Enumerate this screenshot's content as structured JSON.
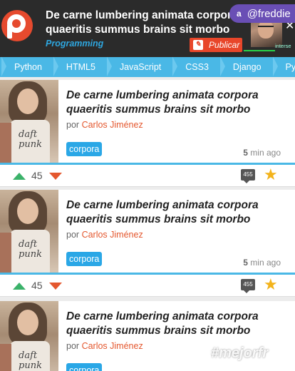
{
  "header": {
    "title": "De carne lumbering animata corpora quaeritis summus brains sit morbo",
    "category": "Programming",
    "publish_label": "Publicar",
    "handle": "@freddie",
    "handle_icon": "twitter-icon",
    "overlay_label": "interse"
  },
  "tags": [
    "Python",
    "HTML5",
    "JavaScript",
    "CSS3",
    "Django",
    "Python"
  ],
  "posts": [
    {
      "title": "De carne lumbering animata corpora quaeritis summus brains sit morbo",
      "by": "por",
      "author": "Carlos Jiménez",
      "category": "corpora",
      "time_num": "5",
      "time_unit": "min ago",
      "votes": "45",
      "comments": "455",
      "thumb_text": "daft punk"
    },
    {
      "title": "De carne lumbering animata corpora quaeritis summus brains sit morbo",
      "by": "por",
      "author": "Carlos Jiménez",
      "category": "corpora",
      "time_num": "5",
      "time_unit": "min ago",
      "votes": "45",
      "comments": "455",
      "thumb_text": "daft punk"
    },
    {
      "title": "De carne lumbering animata corpora quaeritis summus brains sit morbo",
      "by": "por",
      "author": "Carlos Jiménez",
      "category": "corpora",
      "thumb_text": "daft punk"
    }
  ],
  "watermark": "#mejorfr",
  "colors": {
    "brand": "#e64a2e",
    "accent": "#4ab8e6",
    "badge": "#2aa7e6",
    "upvote": "#3bb26a",
    "downvote": "#e4572e",
    "star": "#f3b31b"
  }
}
